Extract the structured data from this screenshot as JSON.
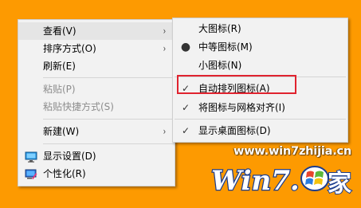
{
  "main_menu": {
    "items": [
      {
        "label": "查看(V)"
      },
      {
        "label": "排序方式(O)"
      },
      {
        "label": "刷新(E)"
      },
      {
        "label": "粘贴(P)"
      },
      {
        "label": "粘贴快捷方式(S)"
      },
      {
        "label": "新建(W)"
      },
      {
        "label": "显示设置(D)",
        "icon": "display-settings-icon"
      },
      {
        "label": "个性化(R)",
        "icon": "personalize-icon"
      }
    ]
  },
  "view_submenu": {
    "items": [
      {
        "label": "大图标(R)"
      },
      {
        "label": "中等图标(M)",
        "checked": true
      },
      {
        "label": "小图标(N)"
      },
      {
        "label": "自动排列图标(A)",
        "checked": true
      },
      {
        "label": "将图标与网格对齐(I)",
        "checked": true
      },
      {
        "label": "显示桌面图标(D)",
        "checked": true
      }
    ]
  },
  "glyphs": {
    "submenu_arrow": "›",
    "check": "✓",
    "bullet": "●"
  },
  "watermark": {
    "url": "www.win7zhijia.cn",
    "logo_text": "Win7.",
    "logo_suffix": "家"
  },
  "colors": {
    "desktop_background": "#fd9a01",
    "highlight_box": "#e0232f"
  }
}
